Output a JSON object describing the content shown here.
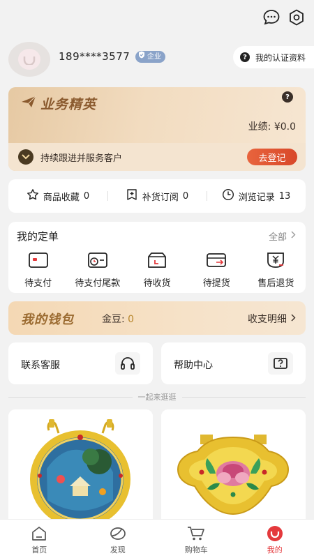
{
  "header": {
    "icons": [
      "chat-icon",
      "settings-icon"
    ]
  },
  "profile": {
    "phone": "189****3577",
    "badge": "企业",
    "cert_label": "我的认证资料"
  },
  "elite": {
    "title": "业务精英",
    "help": "?",
    "performance_label": "业绩: ",
    "performance_value": "¥0.0",
    "tip": "持续跟进并服务客户",
    "register_button": "去登记"
  },
  "stats": [
    {
      "label": "商品收藏",
      "count": "0",
      "icon": "star-icon"
    },
    {
      "label": "补货订阅",
      "count": "0",
      "icon": "bookmark-plus-icon"
    },
    {
      "label": "浏览记录",
      "count": "13",
      "icon": "clock-icon"
    }
  ],
  "orders": {
    "title": "我的定单",
    "all_label": "全部",
    "items": [
      {
        "label": "待支付",
        "icon": "wallet-card-icon"
      },
      {
        "label": "待支付尾款",
        "icon": "wallet-balance-icon"
      },
      {
        "label": "待收货",
        "icon": "box-icon"
      },
      {
        "label": "待提货",
        "icon": "pickup-card-icon"
      },
      {
        "label": "售后退货",
        "icon": "refund-icon"
      }
    ]
  },
  "wallet": {
    "title": "我的钱包",
    "beans_label": "金豆: ",
    "beans_value": "0",
    "detail_label": "收支明细"
  },
  "services": {
    "contact": "联系客服",
    "help": "帮助中心"
  },
  "divider_text": "一起来逛逛",
  "tabs": [
    {
      "label": "首页",
      "icon": "home-icon"
    },
    {
      "label": "发现",
      "icon": "discover-icon"
    },
    {
      "label": "购物车",
      "icon": "cart-icon"
    },
    {
      "label": "我的",
      "icon": "mine-icon"
    }
  ],
  "colors": {
    "accent_red": "#e4393c",
    "gold_text": "#8a5a2e"
  }
}
